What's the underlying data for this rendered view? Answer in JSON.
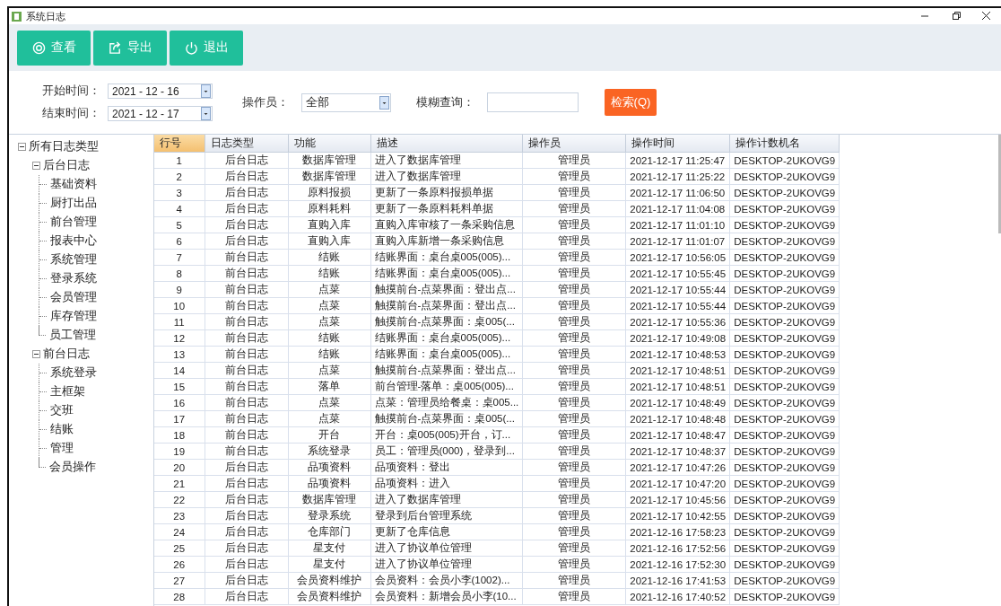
{
  "window": {
    "title": "系统日志"
  },
  "toolbar": [
    {
      "kind": "view",
      "label": "查看"
    },
    {
      "kind": "export",
      "label": "导出"
    },
    {
      "kind": "exit",
      "label": "退出"
    }
  ],
  "filters": {
    "start": {
      "label": "开始时间：",
      "value": "2021 - 12 - 16"
    },
    "end": {
      "label": "结束时间：",
      "value": "2021 - 12 - 17"
    },
    "operator": {
      "label": "操作员：",
      "value": "全部"
    },
    "fuzzy": {
      "label": "模糊查询："
    },
    "search_button": "检索(Q)"
  },
  "tree": {
    "label": "所有日志类型",
    "expanded": true,
    "children": [
      {
        "label": "后台日志",
        "expanded": true,
        "children": [
          {
            "label": "基础资料"
          },
          {
            "label": "厨打出品"
          },
          {
            "label": "前台管理"
          },
          {
            "label": "报表中心"
          },
          {
            "label": "系统管理"
          },
          {
            "label": "登录系统"
          },
          {
            "label": "会员管理"
          },
          {
            "label": "库存管理"
          },
          {
            "label": "员工管理"
          }
        ]
      },
      {
        "label": "前台日志",
        "expanded": true,
        "children": [
          {
            "label": "系统登录"
          },
          {
            "label": "主框架"
          },
          {
            "label": "交班"
          },
          {
            "label": "结账"
          },
          {
            "label": "管理"
          },
          {
            "label": "会员操作"
          }
        ]
      }
    ]
  },
  "table": {
    "columns": [
      {
        "label": "行号",
        "selected": true
      },
      {
        "label": "日志类型",
        "selected": false
      },
      {
        "label": "功能",
        "selected": false
      },
      {
        "label": "描述",
        "selected": false
      },
      {
        "label": "操作员",
        "selected": false
      },
      {
        "label": "操作时间",
        "selected": false
      },
      {
        "label": "操作计数机名",
        "selected": false
      }
    ],
    "rows": [
      [
        "1",
        "后台日志",
        "数据库管理",
        "进入了数据库管理",
        "管理员",
        "2021-12-17 11:25:47",
        "DESKTOP-2UKOVG9"
      ],
      [
        "2",
        "后台日志",
        "数据库管理",
        "进入了数据库管理",
        "管理员",
        "2021-12-17 11:25:22",
        "DESKTOP-2UKOVG9"
      ],
      [
        "3",
        "后台日志",
        "原料报损",
        "更新了一条原料报损单据",
        "管理员",
        "2021-12-17 11:06:50",
        "DESKTOP-2UKOVG9"
      ],
      [
        "4",
        "后台日志",
        "原料耗料",
        "更新了一条原料耗料单据",
        "管理员",
        "2021-12-17 11:04:08",
        "DESKTOP-2UKOVG9"
      ],
      [
        "5",
        "后台日志",
        "直购入库",
        "直购入库审核了一条采购信息",
        "管理员",
        "2021-12-17 11:01:10",
        "DESKTOP-2UKOVG9"
      ],
      [
        "6",
        "后台日志",
        "直购入库",
        "直购入库新增一条采购信息",
        "管理员",
        "2021-12-17 11:01:07",
        "DESKTOP-2UKOVG9"
      ],
      [
        "7",
        "前台日志",
        "结账",
        "结账界面：桌台桌005(005)...",
        "管理员",
        "2021-12-17 10:56:05",
        "DESKTOP-2UKOVG9"
      ],
      [
        "8",
        "前台日志",
        "结账",
        "结账界面：桌台桌005(005)...",
        "管理员",
        "2021-12-17 10:55:45",
        "DESKTOP-2UKOVG9"
      ],
      [
        "9",
        "前台日志",
        "点菜",
        "触摸前台-点菜界面：登出点...",
        "管理员",
        "2021-12-17 10:55:44",
        "DESKTOP-2UKOVG9"
      ],
      [
        "10",
        "前台日志",
        "点菜",
        "触摸前台-点菜界面：登出点...",
        "管理员",
        "2021-12-17 10:55:44",
        "DESKTOP-2UKOVG9"
      ],
      [
        "11",
        "前台日志",
        "点菜",
        "触摸前台-点菜界面：桌005(...",
        "管理员",
        "2021-12-17 10:55:36",
        "DESKTOP-2UKOVG9"
      ],
      [
        "12",
        "前台日志",
        "结账",
        "结账界面：桌台桌005(005)...",
        "管理员",
        "2021-12-17 10:49:08",
        "DESKTOP-2UKOVG9"
      ],
      [
        "13",
        "前台日志",
        "结账",
        "结账界面：桌台桌005(005)...",
        "管理员",
        "2021-12-17 10:48:53",
        "DESKTOP-2UKOVG9"
      ],
      [
        "14",
        "前台日志",
        "点菜",
        "触摸前台-点菜界面：登出点...",
        "管理员",
        "2021-12-17 10:48:51",
        "DESKTOP-2UKOVG9"
      ],
      [
        "15",
        "前台日志",
        "落单",
        "前台管理-落单：桌005(005)...",
        "管理员",
        "2021-12-17 10:48:51",
        "DESKTOP-2UKOVG9"
      ],
      [
        "16",
        "前台日志",
        "点菜",
        "点菜：管理员给餐桌：桌005...",
        "管理员",
        "2021-12-17 10:48:49",
        "DESKTOP-2UKOVG9"
      ],
      [
        "17",
        "前台日志",
        "点菜",
        "触摸前台-点菜界面：桌005(...",
        "管理员",
        "2021-12-17 10:48:48",
        "DESKTOP-2UKOVG9"
      ],
      [
        "18",
        "前台日志",
        "开台",
        "开台：桌005(005)开台，订...",
        "管理员",
        "2021-12-17 10:48:47",
        "DESKTOP-2UKOVG9"
      ],
      [
        "19",
        "前台日志",
        "系统登录",
        "员工：管理员(000)，登录到...",
        "管理员",
        "2021-12-17 10:48:37",
        "DESKTOP-2UKOVG9"
      ],
      [
        "20",
        "后台日志",
        "品项资料",
        "品项资料：登出",
        "管理员",
        "2021-12-17 10:47:26",
        "DESKTOP-2UKOVG9"
      ],
      [
        "21",
        "后台日志",
        "品项资料",
        "品项资料：进入",
        "管理员",
        "2021-12-17 10:47:20",
        "DESKTOP-2UKOVG9"
      ],
      [
        "22",
        "后台日志",
        "数据库管理",
        "进入了数据库管理",
        "管理员",
        "2021-12-17 10:45:56",
        "DESKTOP-2UKOVG9"
      ],
      [
        "23",
        "后台日志",
        "登录系统",
        "登录到后台管理系统",
        "管理员",
        "2021-12-17 10:42:55",
        "DESKTOP-2UKOVG9"
      ],
      [
        "24",
        "后台日志",
        "仓库部门",
        "更新了仓库信息",
        "管理员",
        "2021-12-16 17:58:23",
        "DESKTOP-2UKOVG9"
      ],
      [
        "25",
        "后台日志",
        "星支付",
        "进入了协议单位管理",
        "管理员",
        "2021-12-16 17:52:56",
        "DESKTOP-2UKOVG9"
      ],
      [
        "26",
        "后台日志",
        "星支付",
        "进入了协议单位管理",
        "管理员",
        "2021-12-16 17:52:30",
        "DESKTOP-2UKOVG9"
      ],
      [
        "27",
        "后台日志",
        "会员资料维护",
        "会员资料：会员小李(1002)...",
        "管理员",
        "2021-12-16 17:41:53",
        "DESKTOP-2UKOVG9"
      ],
      [
        "28",
        "后台日志",
        "会员资料维护",
        "会员资料：新增会员小李(10...",
        "管理员",
        "2021-12-16 17:40:52",
        "DESKTOP-2UKOVG9"
      ]
    ]
  }
}
